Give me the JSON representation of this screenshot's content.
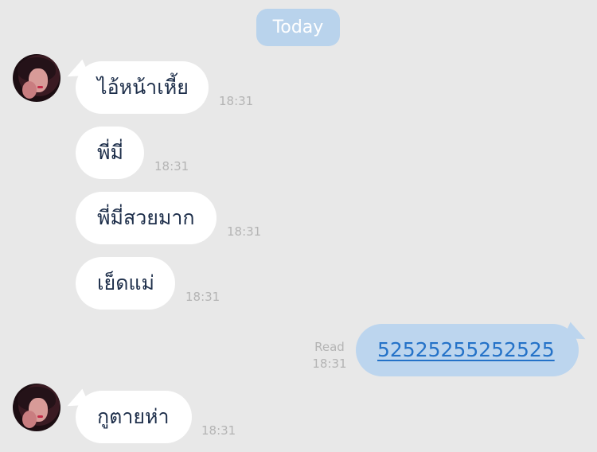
{
  "date_divider": "Today",
  "messages": [
    {
      "direction": "incoming",
      "text": "ไอ้หน้าเหี้ย",
      "time": "18:31"
    },
    {
      "direction": "incoming",
      "text": "พี่มี่",
      "time": "18:31"
    },
    {
      "direction": "incoming",
      "text": "พี่มี่สวยมาก",
      "time": "18:31"
    },
    {
      "direction": "incoming",
      "text": "เย็ดแม่",
      "time": "18:31"
    },
    {
      "direction": "outgoing",
      "text": "52525255252525",
      "read_label": "Read",
      "time": "18:31",
      "is_link": true
    },
    {
      "direction": "incoming",
      "text": "กูตายห่า",
      "time": "18:31"
    }
  ],
  "colors": {
    "background": "#e8e8e8",
    "incoming_bubble": "#ffffff",
    "outgoing_bubble": "#bcd5ee",
    "link": "#2472c8",
    "timestamp": "#b4b4b4",
    "date_pill": "#b9d3ec"
  },
  "icons": {
    "sender_avatar": "profile-photo"
  }
}
